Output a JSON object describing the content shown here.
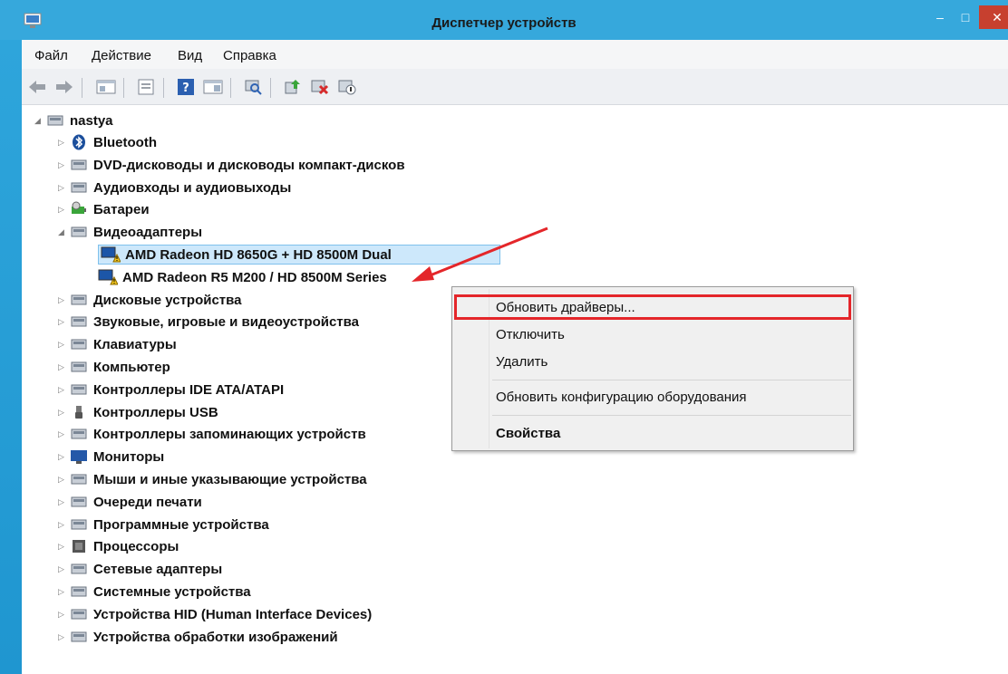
{
  "window": {
    "title": "Диспетчер устройств",
    "controls": {
      "minimize": "–",
      "maximize": "□",
      "close": "✕"
    }
  },
  "menu": [
    "Файл",
    "Действие",
    "Вид",
    "Справка"
  ],
  "toolbar": {
    "icons": [
      "back-icon",
      "forward-icon",
      "show-hide-tree-icon",
      "properties-icon",
      "help-icon",
      "view-icon",
      "scan-hardware-icon",
      "update-driver-icon",
      "uninstall-icon",
      "disable-icon"
    ]
  },
  "tree": {
    "root": "nastya",
    "categories": [
      "Bluetooth",
      "DVD-дисководы и дисководы компакт-дисков",
      "Аудиовходы и аудиовыходы",
      "Батареи",
      "Видеоадаптеры",
      "Дисковые устройства",
      "Звуковые, игровые и видеоустройства",
      "Клавиатуры",
      "Компьютер",
      "Контроллеры IDE ATA/ATAPI",
      "Контроллеры USB",
      "Контроллеры запоминающих устройств",
      "Мониторы",
      "Мыши и иные указывающие устройства",
      "Очереди печати",
      "Программные устройства",
      "Процессоры",
      "Сетевые адаптеры",
      "Системные устройства",
      "Устройства HID (Human Interface Devices)",
      "Устройства обработки изображений"
    ],
    "video_adapters": [
      "AMD Radeon HD 8650G + HD 8500M Dual",
      "AMD Radeon R5 M200 / HD 8500M Series"
    ]
  },
  "context_menu": {
    "items": [
      "Обновить драйверы...",
      "Отключить",
      "Удалить",
      "Обновить конфигурацию оборудования",
      "Свойства"
    ]
  },
  "colors": {
    "titlebar": "#36a8dc",
    "selection": "#cde8fb",
    "highlight": "#e4262a"
  }
}
